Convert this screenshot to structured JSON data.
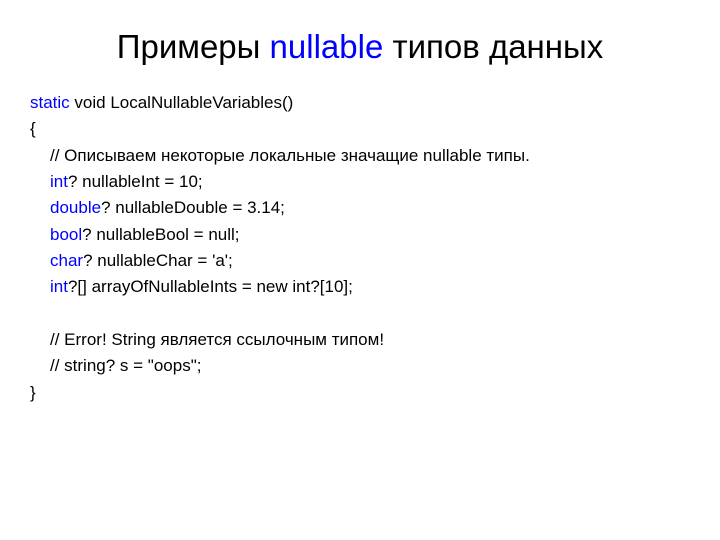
{
  "title": {
    "part1": "Примеры ",
    "keyword": "nullable",
    "part2": " типов данных"
  },
  "code": {
    "l1_kw": "static",
    "l1_rest": " void LocalNullableVariables()",
    "l2": "{",
    "l3": "// Описываем некоторые локальные значащие nullable типы.",
    "l4_kw": "int",
    "l4_rest": "? nullableInt = 10;",
    "l5_kw": "double",
    "l5_rest": "? nullableDouble = 3.14;",
    "l6_kw": "bool",
    "l6_rest": "? nullableBool = null;",
    "l7_kw": "char",
    "l7_rest": "? nullableChar = 'a';",
    "l8_kw": "int",
    "l8_rest": "?[] arrayOfNullableInts = new int?[10];",
    "l9": "",
    "l10": "// Error! String является ссылочным типом!",
    "l11": "// string? s = \"oops\";",
    "l12": "}"
  }
}
